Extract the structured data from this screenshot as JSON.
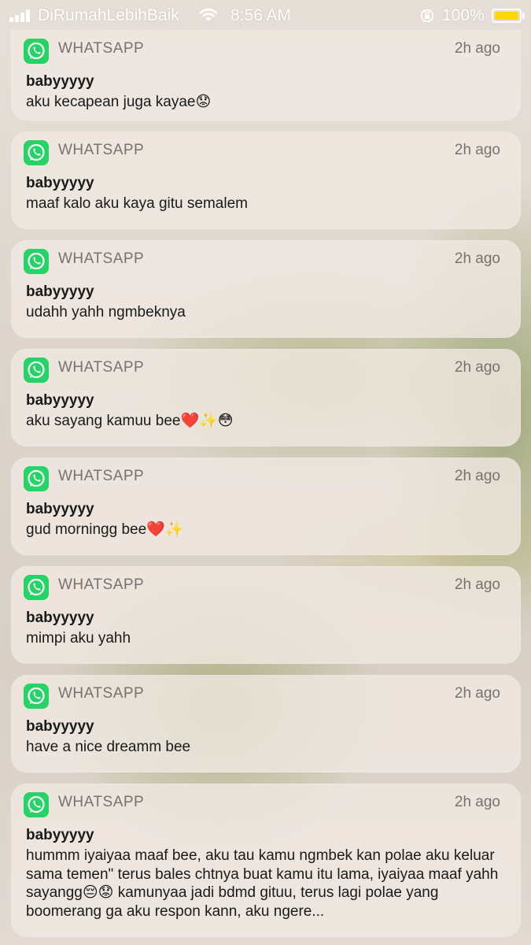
{
  "status_bar": {
    "carrier": "DiRumahLebihBaik",
    "time": "8:56 AM",
    "battery": "100%",
    "battery_color": "#ffd60a",
    "icons": [
      "signal-icon",
      "wifi-icon",
      "orientation-lock-icon",
      "battery-icon"
    ]
  },
  "app_icon": "whatsapp-icon",
  "accent_color": "#25d366",
  "notifications": [
    {
      "app": "WHATSAPP",
      "time": "2h ago",
      "title": "babyyyyy",
      "body": "aku kecapean juga kayae😟"
    },
    {
      "app": "WHATSAPP",
      "time": "2h ago",
      "title": "babyyyyy",
      "body": "maaf kalo aku kaya gitu semalem"
    },
    {
      "app": "WHATSAPP",
      "time": "2h ago",
      "title": "babyyyyy",
      "body": "udahh yahh ngmbeknya"
    },
    {
      "app": "WHATSAPP",
      "time": "2h ago",
      "title": "babyyyyy",
      "body": "aku sayang kamuu bee❤️✨😳"
    },
    {
      "app": "WHATSAPP",
      "time": "2h ago",
      "title": "babyyyyy",
      "body": "gud morningg bee❤️✨"
    },
    {
      "app": "WHATSAPP",
      "time": "2h ago",
      "title": "babyyyyy",
      "body": "mimpi aku yahh"
    },
    {
      "app": "WHATSAPP",
      "time": "2h ago",
      "title": "babyyyyy",
      "body": "have a nice dreamm bee"
    },
    {
      "app": "WHATSAPP",
      "time": "2h ago",
      "title": "babyyyyy",
      "body": "hummm iyaiyaa maaf bee, aku tau kamu ngmbek kan polae aku keluar sama temen\" terus bales chtnya buat kamu itu lama, iyaiyaa maaf yahh sayangg😔😟 kamunyaa jadi bdmd gituu, terus lagi polae yang boomerang ga aku respon kann, aku ngere..."
    }
  ]
}
